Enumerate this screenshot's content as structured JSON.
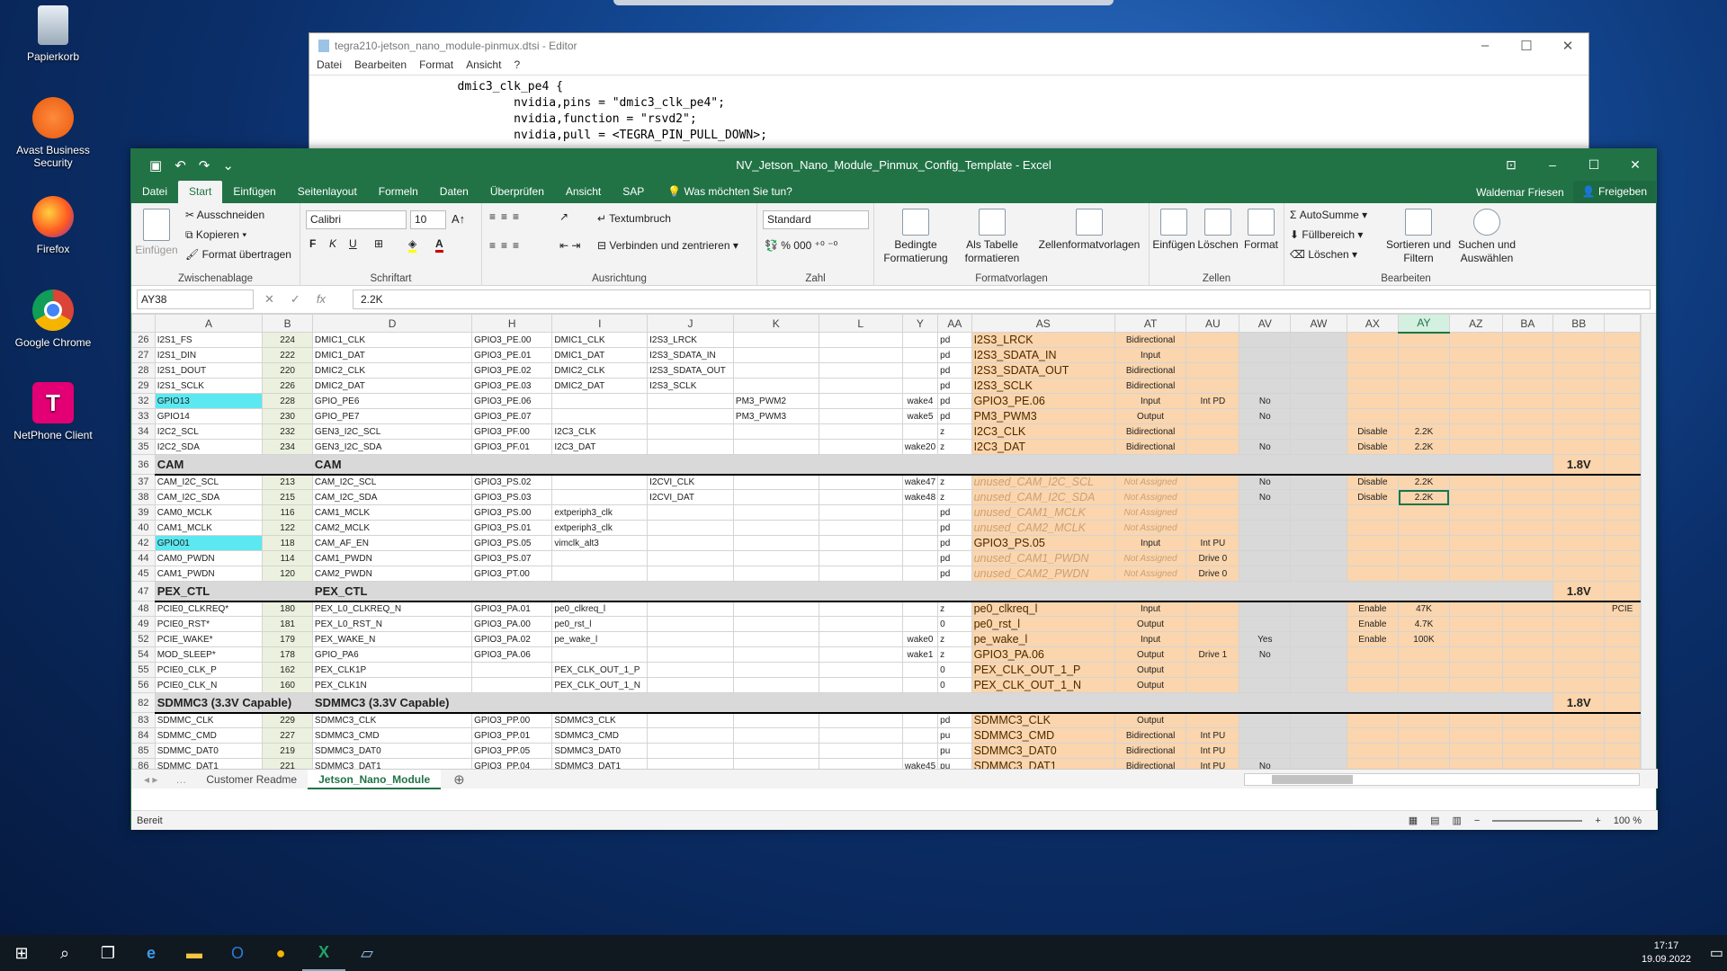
{
  "desktop": {
    "icons": [
      {
        "label": "Papierkorb",
        "name": "recycle-bin-icon"
      },
      {
        "label": "Avast Business Security",
        "name": "avast-icon"
      },
      {
        "label": "Firefox",
        "name": "firefox-icon"
      },
      {
        "label": "Google Chrome",
        "name": "chrome-icon"
      },
      {
        "label": "NetPhone Client",
        "name": "netphone-icon"
      }
    ]
  },
  "notepad": {
    "title": "tegra210-jetson_nano_module-pinmux.dtsi - Editor",
    "menu": [
      "Datei",
      "Bearbeiten",
      "Format",
      "Ansicht",
      "?"
    ],
    "content": "                    dmic3_clk_pe4 {\n                            nvidia,pins = \"dmic3_clk_pe4\";\n                            nvidia,function = \"rsvd2\";\n                            nvidia,pull = <TEGRA_PIN_PULL_DOWN>;"
  },
  "excel": {
    "title": "NV_Jetson_Nano_Module_Pinmux_Config_Template - Excel",
    "tabs": [
      "Datei",
      "Start",
      "Einfügen",
      "Seitenlayout",
      "Formeln",
      "Daten",
      "Überprüfen",
      "Ansicht",
      "SAP"
    ],
    "tellme": "Was möchten Sie tun?",
    "user": "Waldemar Friesen",
    "share": "Freigeben",
    "ribbon": {
      "paste": "Einfügen",
      "cut": "Ausschneiden",
      "copy": "Kopieren",
      "format_painter": "Format übertragen",
      "g_clipboard": "Zwischenablage",
      "font": "Calibri",
      "size": "10",
      "g_font": "Schriftart",
      "wrap": "Textumbruch",
      "merge": "Verbinden und zentrieren",
      "g_align": "Ausrichtung",
      "numfmt": "Standard",
      "g_number": "Zahl",
      "cond": "Bedingte Formatierung",
      "astable": "Als Tabelle formatieren",
      "cellstyles": "Zellenformatvorlagen",
      "g_styles": "Formatvorlagen",
      "insert": "Einfügen",
      "delete": "Löschen",
      "format": "Format",
      "g_cells": "Zellen",
      "autosum": "AutoSumme",
      "fill": "Füllbereich",
      "clear": "Löschen",
      "sort": "Sortieren und Filtern",
      "find": "Suchen und Auswählen",
      "g_edit": "Bearbeiten"
    },
    "namebox": "AY38",
    "formula": "2.2K",
    "columns": [
      "A",
      "B",
      "D",
      "H",
      "I",
      "J",
      "K",
      "L",
      "Y",
      "AA",
      "AS",
      "AT",
      "AU",
      "AV",
      "AW",
      "AX",
      "AY",
      "AZ",
      "BA",
      "BB",
      ""
    ],
    "sheets": [
      "Customer Readme",
      "Jetson_Nano_Module"
    ],
    "status": "Bereit",
    "zoom": "100 %"
  },
  "rows": [
    {
      "r": "26",
      "a": "I2S1_FS",
      "b": "224",
      "d": "DMIC1_CLK",
      "h": "GPIO3_PE.00",
      "i": "DMIC1_CLK",
      "j": "I2S3_LRCK",
      "k": "",
      "y": "",
      "aa": "pd",
      "as": "I2S3_LRCK",
      "at": "Bidirectional",
      "au": "",
      "av": "",
      "ax": "",
      "ay": "",
      "bb": ""
    },
    {
      "r": "27",
      "a": "I2S1_DIN",
      "b": "222",
      "d": "DMIC1_DAT",
      "h": "GPIO3_PE.01",
      "i": "DMIC1_DAT",
      "j": "I2S3_SDATA_IN",
      "k": "",
      "y": "",
      "aa": "pd",
      "as": "I2S3_SDATA_IN",
      "at": "Input",
      "au": "",
      "av": "",
      "ax": "",
      "ay": "",
      "bb": ""
    },
    {
      "r": "28",
      "a": "I2S1_DOUT",
      "b": "220",
      "d": "DMIC2_CLK",
      "h": "GPIO3_PE.02",
      "i": "DMIC2_CLK",
      "j": "I2S3_SDATA_OUT",
      "k": "",
      "y": "",
      "aa": "pd",
      "as": "I2S3_SDATA_OUT",
      "at": "Bidirectional",
      "au": "",
      "av": "",
      "ax": "",
      "ay": "",
      "bb": ""
    },
    {
      "r": "29",
      "a": "I2S1_SCLK",
      "b": "226",
      "d": "DMIC2_DAT",
      "h": "GPIO3_PE.03",
      "i": "DMIC2_DAT",
      "j": "I2S3_SCLK",
      "k": "",
      "y": "",
      "aa": "pd",
      "as": "I2S3_SCLK",
      "at": "Bidirectional",
      "au": "",
      "av": "",
      "ax": "",
      "ay": "",
      "bb": ""
    },
    {
      "r": "32",
      "a": "GPIO13",
      "b": "228",
      "d": "GPIO_PE6",
      "h": "GPIO3_PE.06",
      "i": "",
      "j": "",
      "k": "PM3_PWM2",
      "y": "wake4",
      "aa": "pd",
      "as": "GPIO3_PE.06",
      "at": "Input",
      "au": "Int PD",
      "av": "No",
      "ax": "",
      "ay": "",
      "bb": "",
      "cyan": true
    },
    {
      "r": "33",
      "a": "GPIO14",
      "b": "230",
      "d": "GPIO_PE7",
      "h": "GPIO3_PE.07",
      "i": "",
      "j": "",
      "k": "PM3_PWM3",
      "y": "wake5",
      "aa": "pd",
      "as": "PM3_PWM3",
      "at": "Output",
      "au": "",
      "av": "No",
      "ax": "",
      "ay": "",
      "bb": ""
    },
    {
      "r": "34",
      "a": "I2C2_SCL",
      "b": "232",
      "d": "GEN3_I2C_SCL",
      "h": "GPIO3_PF.00",
      "i": "I2C3_CLK",
      "j": "",
      "k": "",
      "y": "",
      "aa": "z",
      "as": "I2C3_CLK",
      "at": "Bidirectional",
      "au": "",
      "av": "",
      "ax": "Disable",
      "ay": "2.2K",
      "bb": ""
    },
    {
      "r": "35",
      "a": "I2C2_SDA",
      "b": "234",
      "d": "GEN3_I2C_SDA",
      "h": "GPIO3_PF.01",
      "i": "I2C3_DAT",
      "j": "",
      "k": "",
      "y": "wake20",
      "aa": "z",
      "as": "I2C3_DAT",
      "at": "Bidirectional",
      "au": "",
      "av": "No",
      "ax": "Disable",
      "ay": "2.2K",
      "bb": ""
    },
    {
      "sec": "CAM",
      "r": "36",
      "bb": "1.8V"
    },
    {
      "r": "37",
      "a": "CAM_I2C_SCL",
      "b": "213",
      "d": "CAM_I2C_SCL",
      "h": "GPIO3_PS.02",
      "i": "",
      "j": "I2CVI_CLK",
      "k": "",
      "y": "wake47",
      "aa": "z",
      "as": "unused_CAM_I2C_SCL",
      "at": "Not Assigned",
      "au": "",
      "av": "No",
      "ax": "Disable",
      "ay": "2.2K",
      "bb": "",
      "un": true
    },
    {
      "r": "38",
      "a": "CAM_I2C_SDA",
      "b": "215",
      "d": "CAM_I2C_SDA",
      "h": "GPIO3_PS.03",
      "i": "",
      "j": "I2CVI_DAT",
      "k": "",
      "y": "wake48",
      "aa": "z",
      "as": "unused_CAM_I2C_SDA",
      "at": "Not Assigned",
      "au": "",
      "av": "No",
      "ax": "Disable",
      "ay": "2.2K",
      "bb": "",
      "un": true,
      "sel": true
    },
    {
      "r": "39",
      "a": "CAM0_MCLK",
      "b": "116",
      "d": "CAM1_MCLK",
      "h": "GPIO3_PS.00",
      "i": "extperiph3_clk",
      "j": "",
      "k": "",
      "y": "",
      "aa": "pd",
      "as": "unused_CAM1_MCLK",
      "at": "Not Assigned",
      "au": "",
      "av": "",
      "ax": "",
      "ay": "",
      "bb": "",
      "un": true
    },
    {
      "r": "40",
      "a": "CAM1_MCLK",
      "b": "122",
      "d": "CAM2_MCLK",
      "h": "GPIO3_PS.01",
      "i": "extperiph3_clk",
      "j": "",
      "k": "",
      "y": "",
      "aa": "pd",
      "as": "unused_CAM2_MCLK",
      "at": "Not Assigned",
      "au": "",
      "av": "",
      "ax": "",
      "ay": "",
      "bb": "",
      "un": true
    },
    {
      "r": "42",
      "a": "GPIO01",
      "b": "118",
      "d": "CAM_AF_EN",
      "h": "GPIO3_PS.05",
      "i": "vimclk_alt3",
      "j": "",
      "k": "",
      "y": "",
      "aa": "pd",
      "as": "GPIO3_PS.05",
      "at": "Input",
      "au": "Int PU",
      "av": "",
      "ax": "",
      "ay": "",
      "bb": "",
      "cyan": true
    },
    {
      "r": "44",
      "a": "CAM0_PWDN",
      "b": "114",
      "d": "CAM1_PWDN",
      "h": "GPIO3_PS.07",
      "i": "",
      "j": "",
      "k": "",
      "y": "",
      "aa": "pd",
      "as": "unused_CAM1_PWDN",
      "at": "Not Assigned",
      "au": "Drive 0",
      "av": "",
      "ax": "",
      "ay": "",
      "bb": "",
      "un": true
    },
    {
      "r": "45",
      "a": "CAM1_PWDN",
      "b": "120",
      "d": "CAM2_PWDN",
      "h": "GPIO3_PT.00",
      "i": "",
      "j": "",
      "k": "",
      "y": "",
      "aa": "pd",
      "as": "unused_CAM2_PWDN",
      "at": "Not Assigned",
      "au": "Drive 0",
      "av": "",
      "ax": "",
      "ay": "",
      "bb": "",
      "un": true
    },
    {
      "sec": "PEX_CTL",
      "r": "47",
      "bb": "1.8V"
    },
    {
      "r": "48",
      "a": "PCIE0_CLKREQ*",
      "b": "180",
      "d": "PEX_L0_CLKREQ_N",
      "h": "GPIO3_PA.01",
      "i": "pe0_clkreq_l",
      "j": "",
      "k": "",
      "y": "",
      "aa": "z",
      "as": "pe0_clkreq_l",
      "at": "Input",
      "au": "",
      "av": "",
      "ax": "Enable",
      "ay": "47K",
      "bb": "",
      "x": "PCIE"
    },
    {
      "r": "49",
      "a": "PCIE0_RST*",
      "b": "181",
      "d": "PEX_L0_RST_N",
      "h": "GPIO3_PA.00",
      "i": "pe0_rst_l",
      "j": "",
      "k": "",
      "y": "",
      "aa": "0",
      "as": "pe0_rst_l",
      "at": "Output",
      "au": "",
      "av": "",
      "ax": "Enable",
      "ay": "4.7K",
      "bb": ""
    },
    {
      "r": "52",
      "a": "PCIE_WAKE*",
      "b": "179",
      "d": "PEX_WAKE_N",
      "h": "GPIO3_PA.02",
      "i": "pe_wake_l",
      "j": "",
      "k": "",
      "y": "wake0",
      "aa": "z",
      "as": "pe_wake_l",
      "at": "Input",
      "au": "",
      "av": "Yes",
      "ax": "Enable",
      "ay": "100K",
      "bb": ""
    },
    {
      "r": "54",
      "a": "MOD_SLEEP*",
      "b": "178",
      "d": "GPIO_PA6",
      "h": "GPIO3_PA.06",
      "i": "",
      "j": "",
      "k": "",
      "y": "wake1",
      "aa": "z",
      "as": "GPIO3_PA.06",
      "at": "Output",
      "au": "Drive 1",
      "av": "No",
      "ax": "",
      "ay": "",
      "bb": ""
    },
    {
      "r": "55",
      "a": "PCIE0_CLK_P",
      "b": "162",
      "d": "PEX_CLK1P",
      "h": "",
      "i": "PEX_CLK_OUT_1_P",
      "j": "",
      "k": "",
      "y": "",
      "aa": "0",
      "as": "PEX_CLK_OUT_1_P",
      "at": "Output",
      "au": "",
      "av": "",
      "ax": "",
      "ay": "",
      "bb": ""
    },
    {
      "r": "56",
      "a": "PCIE0_CLK_N",
      "b": "160",
      "d": "PEX_CLK1N",
      "h": "",
      "i": "PEX_CLK_OUT_1_N",
      "j": "",
      "k": "",
      "y": "",
      "aa": "0",
      "as": "PEX_CLK_OUT_1_N",
      "at": "Output",
      "au": "",
      "av": "",
      "ax": "",
      "ay": "",
      "bb": ""
    },
    {
      "sec": "SDMMC3 (3.3V Capable)",
      "r": "82",
      "bb": "1.8V"
    },
    {
      "r": "83",
      "a": "SDMMC_CLK",
      "b": "229",
      "d": "SDMMC3_CLK",
      "h": "GPIO3_PP.00",
      "i": "SDMMC3_CLK",
      "j": "",
      "k": "",
      "y": "",
      "aa": "pd",
      "as": "SDMMC3_CLK",
      "at": "Output",
      "au": "",
      "av": "",
      "ax": "",
      "ay": "",
      "bb": ""
    },
    {
      "r": "84",
      "a": "SDMMC_CMD",
      "b": "227",
      "d": "SDMMC3_CMD",
      "h": "GPIO3_PP.01",
      "i": "SDMMC3_CMD",
      "j": "",
      "k": "",
      "y": "",
      "aa": "pu",
      "as": "SDMMC3_CMD",
      "at": "Bidirectional",
      "au": "Int PU",
      "av": "",
      "ax": "",
      "ay": "",
      "bb": ""
    },
    {
      "r": "85",
      "a": "SDMMC_DAT0",
      "b": "219",
      "d": "SDMMC3_DAT0",
      "h": "GPIO3_PP.05",
      "i": "SDMMC3_DAT0",
      "j": "",
      "k": "",
      "y": "",
      "aa": "pu",
      "as": "SDMMC3_DAT0",
      "at": "Bidirectional",
      "au": "Int PU",
      "av": "",
      "ax": "",
      "ay": "",
      "bb": ""
    },
    {
      "r": "86",
      "a": "SDMMC_DAT1",
      "b": "221",
      "d": "SDMMC3_DAT1",
      "h": "GPIO3_PP.04",
      "i": "SDMMC3_DAT1",
      "j": "",
      "k": "",
      "y": "wake45",
      "aa": "pu",
      "as": "SDMMC3_DAT1",
      "at": "Bidirectional",
      "au": "Int PU",
      "av": "No",
      "ax": "",
      "ay": "",
      "bb": ""
    }
  ],
  "taskbar": {
    "time": "17:17",
    "date": "19.09.2022"
  }
}
